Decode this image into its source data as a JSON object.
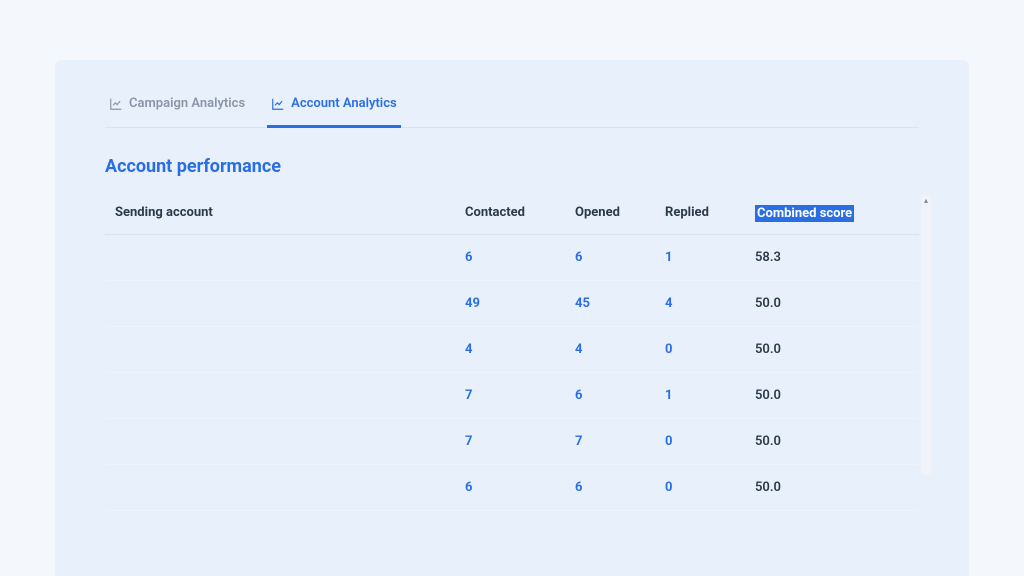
{
  "tabs": {
    "campaign": "Campaign Analytics",
    "account": "Account Analytics"
  },
  "section_title": "Account performance",
  "columns": {
    "sending_account": "Sending account",
    "contacted": "Contacted",
    "opened": "Opened",
    "replied": "Replied",
    "combined_score": "Combined score"
  },
  "rows": [
    {
      "account": "",
      "contacted": "6",
      "opened": "6",
      "replied": "1",
      "score": "58.3"
    },
    {
      "account": "",
      "contacted": "49",
      "opened": "45",
      "replied": "4",
      "score": "50.0"
    },
    {
      "account": "",
      "contacted": "4",
      "opened": "4",
      "replied": "0",
      "score": "50.0"
    },
    {
      "account": "",
      "contacted": "7",
      "opened": "6",
      "replied": "1",
      "score": "50.0"
    },
    {
      "account": "",
      "contacted": "7",
      "opened": "7",
      "replied": "0",
      "score": "50.0"
    },
    {
      "account": "",
      "contacted": "6",
      "opened": "6",
      "replied": "0",
      "score": "50.0"
    }
  ]
}
